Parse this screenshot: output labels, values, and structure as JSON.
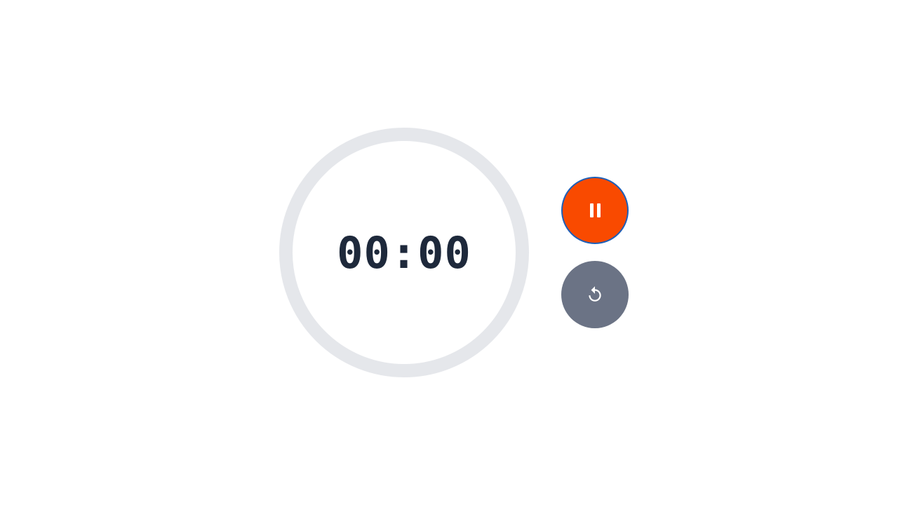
{
  "timer": {
    "display": "00:00"
  },
  "controls": {
    "pause": {
      "icon": "pause-icon",
      "color": "#f94a00"
    },
    "reset": {
      "icon": "reset-icon",
      "color": "#6b7385"
    }
  },
  "colors": {
    "ring": "#e5e7eb",
    "text": "#1e293b",
    "focus_outline": "#1d5fb8"
  }
}
